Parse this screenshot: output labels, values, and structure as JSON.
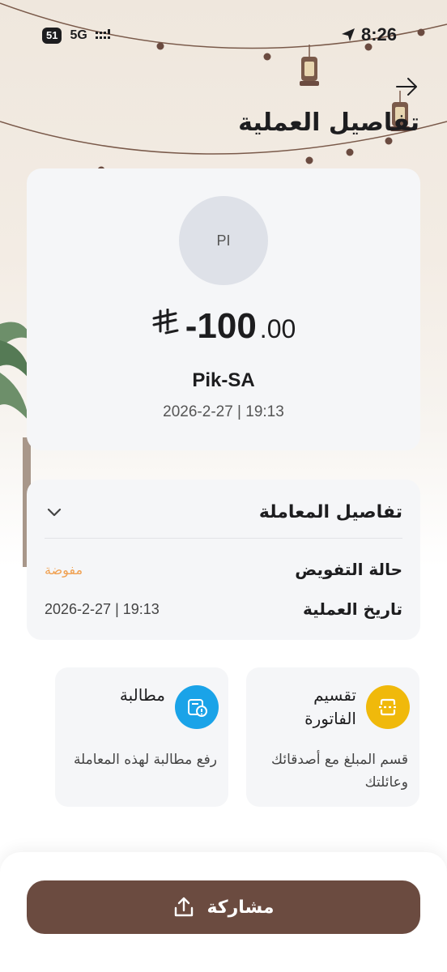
{
  "status_bar": {
    "battery_level": "51",
    "network": "5G",
    "time": "8:26"
  },
  "header": {
    "title": "تفاصيل العملية"
  },
  "transaction": {
    "avatar_initials": "PI",
    "amount_sign_value": "-100",
    "amount_decimals": ".00",
    "merchant": "Pik-SA",
    "datetime": "2026-2-27 | 19:13"
  },
  "details": {
    "title": "تفاصيل المعاملة",
    "rows": [
      {
        "label": "حالة التفويض",
        "value": "مفوضة",
        "color": "#f0a050"
      },
      {
        "label": "تاريخ العملية",
        "value": "2026-2-27 | 19:13"
      }
    ]
  },
  "actions": [
    {
      "title": "مطالبة",
      "description": "رفع مطالبة لهذه المعاملة",
      "icon": "claim-icon",
      "color": "#1aa3e8"
    },
    {
      "title": "تقسيم الفاتورة",
      "description": "قسم المبلغ مع أصدقائك وعائلتك",
      "icon": "split-bill-icon",
      "color": "#f0b90b"
    }
  ],
  "share": {
    "label": "مشاركة",
    "color": "#6b4b40"
  }
}
